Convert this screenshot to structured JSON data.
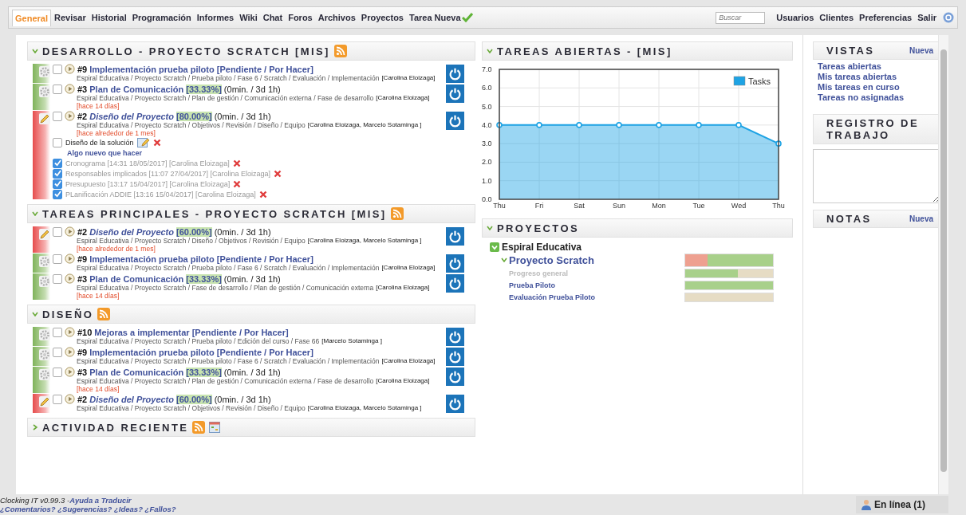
{
  "nav": {
    "tabs": [
      {
        "label": "General",
        "selected": true,
        "kind": "tab"
      },
      {
        "label": "Revisar",
        "selected": false,
        "kind": "tab"
      },
      {
        "label": "Historial",
        "selected": false,
        "kind": "tab"
      },
      {
        "label": "Programación",
        "selected": false,
        "kind": "tab"
      },
      {
        "label": "Informes",
        "selected": false,
        "kind": "tab"
      },
      {
        "label": "Wiki",
        "selected": false,
        "kind": "tab"
      },
      {
        "label": "Chat",
        "selected": false,
        "kind": "tab"
      },
      {
        "label": "Foros",
        "selected": false,
        "kind": "tab"
      },
      {
        "label": "Archivos",
        "selected": false,
        "kind": "tab"
      },
      {
        "label": "Proyectos",
        "selected": false,
        "kind": "tab"
      },
      {
        "label": "Tarea Nueva",
        "selected": false,
        "kind": "new"
      }
    ],
    "search": {
      "placeholder": "Buscar"
    },
    "links": [
      "Usuarios",
      "Clientes",
      "Preferencias",
      "Salir"
    ]
  },
  "sections": [
    {
      "title": "DESARROLLO - PROYECTO SCRATCH [MIS]",
      "expanded": true,
      "calendar": false,
      "tasks": [
        {
          "in_progress": false,
          "checked": false,
          "number": "#9",
          "title": "Implementación prueba piloto [Pendiente / Por Hacer]",
          "path": "Espiral Educativa / Proyecto Scratch / Prueba piloto / Fase 6 / Scratch / Evaluación / Implementación",
          "people": "[Carolina Eloizaga]"
        },
        {
          "in_progress": false,
          "checked": false,
          "number": "#3",
          "title": "Plan de Comunicación",
          "progress": "[33.33%]",
          "time": "(0min. / 3d 1h)",
          "path": "Espiral Educativa / Proyecto Scratch / Plan de gestión / Comunicación externa / Fase de desarrollo",
          "people": "[Carolina Eloizaga]",
          "age": "[hace 14 días]"
        },
        {
          "in_progress": true,
          "checked": false,
          "number": "#2",
          "title": "Diseño del Proyecto",
          "progress": "[80.00%]",
          "time": "(0min. / 3d 1h)",
          "path": "Espiral Educativa / Proyecto Scratch / Objetivos / Revisión / Diseño / Equipo",
          "people": "[Carolina Eloizaga, Marcelo Sotaminga ]",
          "age": "[hace alrededor de 1 mes]",
          "todos": [
            {
              "kind": "item",
              "checked": false,
              "text": "Diseño de la solución"
            },
            {
              "kind": "add",
              "text": "Algo nuevo que hacer"
            },
            {
              "kind": "item",
              "checked": true,
              "text": "Cronograma [14:31 18/05/2017] [Carolina Eloizaga]"
            },
            {
              "kind": "item",
              "checked": true,
              "text": "Responsables implicados [11:07 27/04/2017] [Carolina Eloizaga]"
            },
            {
              "kind": "item",
              "checked": true,
              "text": "Presupuesto [13:17 15/04/2017] [Carolina Eloizaga]"
            },
            {
              "kind": "item",
              "checked": true,
              "text": "PLanificación ADDIE [13:16 15/04/2017] [Carolina Eloizaga]"
            }
          ]
        }
      ]
    },
    {
      "title": "TAREAS PRINCIPALES - PROYECTO SCRATCH [MIS]",
      "expanded": true,
      "calendar": false,
      "tasks": [
        {
          "in_progress": true,
          "checked": false,
          "number": "#2",
          "title": "Diseño del Proyecto",
          "progress": "[60.00%]",
          "time": "(0min. / 3d 1h)",
          "path": "Espiral Educativa / Proyecto Scratch / Diseño / Objetivos / Revisión / Equipo",
          "people": "[Carolina Eloizaga, Marcelo Sotaminga ]",
          "age": "[hace alrededor de 1 mes]"
        },
        {
          "in_progress": false,
          "checked": false,
          "number": "#9",
          "title": "Implementación prueba piloto [Pendiente / Por Hacer]",
          "path": "Espiral Educativa / Proyecto Scratch / Prueba piloto / Fase 6 / Scratch / Evaluación / Implementación",
          "people": "[Carolina Eloizaga]"
        },
        {
          "in_progress": false,
          "checked": false,
          "number": "#3",
          "title": "Plan de Comunicación",
          "progress": "[33.33%]",
          "time": "(0min. / 3d 1h)",
          "path": "Espiral Educativa / Proyecto Scratch / Fase de desarrollo / Plan de gestión / Comunicación externa",
          "people": "[Carolina Eloizaga]",
          "age": "[hace 14 días]"
        }
      ]
    },
    {
      "title": "DISEÑO",
      "expanded": true,
      "calendar": false,
      "tasks": [
        {
          "in_progress": false,
          "checked": false,
          "number": "#10",
          "title": "Mejoras a implementar [Pendiente / Por Hacer]",
          "path": "Espiral Educativa / Proyecto Scratch / Prueba piloto / Edición del curso / Fase 66",
          "people": "[Marcelo Sotaminga ]"
        },
        {
          "in_progress": false,
          "checked": false,
          "number": "#9",
          "title": "Implementación prueba piloto [Pendiente / Por Hacer]",
          "path": "Espiral Educativa / Proyecto Scratch / Prueba piloto / Fase 6 / Scratch / Evaluación / Implementación",
          "people": "[Carolina Eloizaga]"
        },
        {
          "in_progress": false,
          "checked": false,
          "number": "#3",
          "title": "Plan de Comunicación",
          "progress": "[33.33%]",
          "time": "(0min. / 3d 1h)",
          "path": "Espiral Educativa / Proyecto Scratch / Plan de gestión / Comunicación externa / Fase de desarrollo",
          "people": "[Carolina Eloizaga]",
          "age": "[hace 14 días]"
        },
        {
          "in_progress": true,
          "checked": false,
          "number": "#2",
          "title": "Diseño del Proyecto",
          "progress": "[60.00%]",
          "time": "(0min. / 3d 1h)",
          "path": "Espiral Educativa / Proyecto Scratch / Objetivos / Revisión / Diseño / Equipo",
          "people": "[Carolina Eloizaga, Marcelo Sotaminga ]"
        }
      ]
    },
    {
      "title": "ACTIVIDAD RECIENTE",
      "expanded": false,
      "calendar": true
    }
  ],
  "chart": {
    "title": "TAREAS ABIERTAS - [MIS]",
    "expanded": true,
    "chart_data": {
      "type": "area",
      "categories": [
        "Thu",
        "Fri",
        "Sat",
        "Sun",
        "Mon",
        "Tue",
        "Wed",
        "Thu"
      ],
      "series": [
        {
          "name": "Tasks",
          "color": "#1ea3e4",
          "values": [
            4,
            4,
            4,
            4,
            4,
            4,
            4,
            3
          ]
        }
      ],
      "ylim": [
        0,
        7
      ],
      "grid": true,
      "yticks": [
        {
          "value": 0,
          "label": "0.0"
        },
        {
          "value": 1,
          "label": "1.0"
        },
        {
          "value": 2,
          "label": "2.0"
        },
        {
          "value": 3,
          "label": "3.0"
        },
        {
          "value": 4,
          "label": "4.0"
        },
        {
          "value": 5,
          "label": "5.0"
        },
        {
          "value": 6,
          "label": "6.0"
        },
        {
          "value": 7,
          "label": "7.0"
        }
      ]
    }
  },
  "projects": {
    "title": "PROYECTOS",
    "expanded": true,
    "client": "Espiral Educativa",
    "project": {
      "name": "Proyecto Scratch",
      "expanded": true,
      "level": 0.25
    },
    "rows": [
      {
        "name": "Progreso general",
        "disabled": true,
        "level": 0.6
      },
      {
        "name": "Prueba Piloto",
        "disabled": false,
        "level": 1
      },
      {
        "name": "Evaluación Prueba Piloto",
        "disabled": false,
        "level": 0
      }
    ]
  },
  "views": {
    "title": "VISTAS",
    "new_link": "Nueva",
    "items": [
      "Tareas abiertas",
      "Mis tareas abiertas",
      "Mis tareas en curso",
      "Tareas no asignadas"
    ]
  },
  "worklog": {
    "title": "REGISTRO DE TRABAJO"
  },
  "notes": {
    "title": "NOTAS",
    "new_link": "Nueva"
  },
  "footer": {
    "version": "Clocking IT v0.99.3 -",
    "help_link": "Ayuda a Traducir",
    "feedback_link": "¿Comentarios? ¿Sugerencias? ¿Ideas? ¿Fallos?",
    "online": "En línea (1)"
  }
}
